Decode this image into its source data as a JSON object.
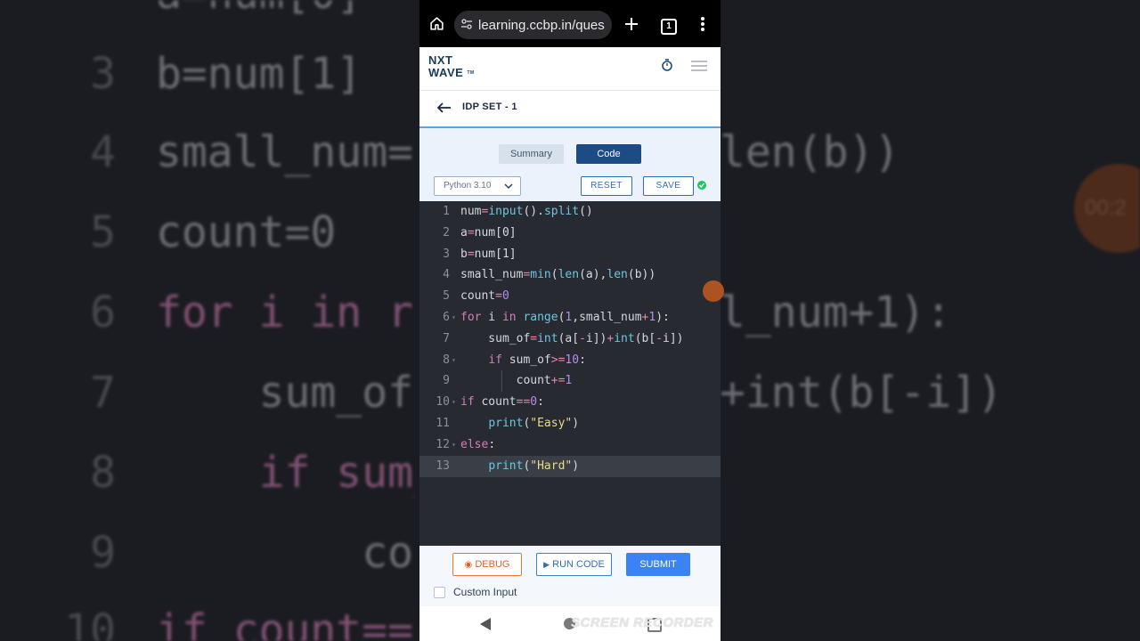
{
  "background": {
    "lines": [
      {
        "num": "3",
        "code": "b=num[1]"
      },
      {
        "num": "4",
        "code": "small_num=min(len(a),len(b))"
      },
      {
        "num": "5",
        "code": "count=0"
      },
      {
        "num": "6",
        "code": "for i in range(1,small_num+1):"
      },
      {
        "num": "7",
        "code": "    sum_of=int(a[-i])+int(b[-i])"
      },
      {
        "num": "8",
        "code": "    if sum_of>=10:"
      },
      {
        "num": "9",
        "code": "        count+=1"
      },
      {
        "num": "10",
        "code": "if count==0:"
      }
    ],
    "right_fragments": [
      "len(b))",
      "l_num+1):",
      "+int(b[-i])"
    ],
    "timer_text": "00:2"
  },
  "browser": {
    "url": "learning.ccbp.in/ques",
    "tab_count": "1",
    "icons": [
      "home-icon",
      "site-settings-icon",
      "new-tab-icon",
      "tabs-icon",
      "more-icon"
    ]
  },
  "app": {
    "logo_line1": "NXT",
    "logo_line2": "WAVE",
    "logo_tm": "TM",
    "page_title": "IDP SET - 1"
  },
  "toolbar": {
    "tabs": [
      {
        "label": "Summary",
        "active": false
      },
      {
        "label": "Code",
        "active": true
      }
    ],
    "language": "Python 3.10",
    "reset_label": "RESET",
    "save_label": "SAVE",
    "saved_color": "#22c55e"
  },
  "editor": {
    "active_line": 13,
    "lines": [
      {
        "n": "1",
        "text": "num=input().split()"
      },
      {
        "n": "2",
        "text": "a=num[0]"
      },
      {
        "n": "3",
        "text": "b=num[1]"
      },
      {
        "n": "4",
        "text": "small_num=min(len(a),len(b))"
      },
      {
        "n": "5",
        "text": "count=0"
      },
      {
        "n": "6",
        "text": "for i in range(1,small_num+1):"
      },
      {
        "n": "7",
        "text": "    sum_of=int(a[-i])+int(b[-i])"
      },
      {
        "n": "8",
        "text": "    if sum_of>=10:"
      },
      {
        "n": "9",
        "text": "        count+=1"
      },
      {
        "n": "10",
        "text": "if count==0:"
      },
      {
        "n": "11",
        "text": "    print(\"Easy\")"
      },
      {
        "n": "12",
        "text": "else:"
      },
      {
        "n": "13",
        "text": "    print(\"Hard\")"
      }
    ]
  },
  "actions": {
    "debug_label": "DEBUG",
    "run_label": "RUN CODE",
    "submit_label": "SUBMIT",
    "custom_input_label": "Custom Input",
    "custom_input_checked": false
  },
  "overlay": {
    "watermark": "SCREEN RECORDER"
  },
  "colors": {
    "brand": "#1c4b86",
    "accent": "#3b82f6",
    "debug": "#e07a3b",
    "editor_bg": "#272a31"
  }
}
